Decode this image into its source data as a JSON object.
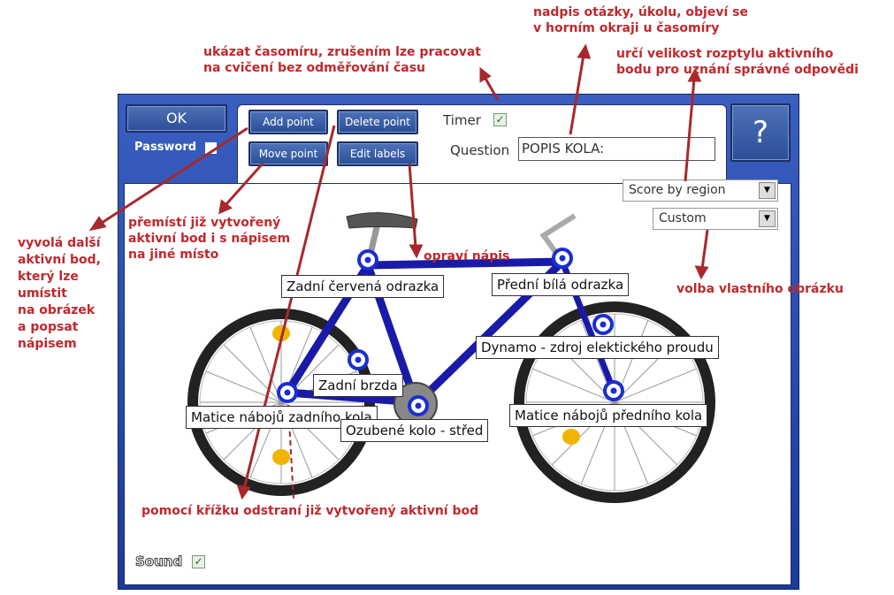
{
  "window": {
    "ok_label": "OK",
    "password_label": "Password",
    "help_label": "?",
    "toolbar": {
      "add_point": "Add point",
      "delete_point": "Delete point",
      "move_point": "Move point",
      "edit_labels": "Edit labels",
      "timer_label": "Timer",
      "timer_checked": true,
      "question_label": "Question",
      "question_value": "POPIS KOLA:"
    },
    "score_select": "Score by region",
    "image_select": "Custom",
    "sound_label": "Sound",
    "sound_checked": true,
    "check_mark": "✓"
  },
  "labels": [
    "Zadní červená odrazka",
    "Přední bílá odrazka",
    "Dynamo - zdroj elektického proudu",
    "Zadní brzda",
    "Matice nábojů zadního kola",
    "Ozubené kolo - střed",
    "Matice nábojů předního kola"
  ],
  "annotations": {
    "question": "nadpis otázky, úkolu, objeví se\nv horním okraji u časomíry",
    "timer": "ukázat časomíru, zrušením lze pracovat\nna cvičení bez odměřování času",
    "score": "určí velikost rozptylu aktivního\nbodu pro uznání správné odpovědi",
    "add": "vyvolá další\naktivní bod,\nkterý lze\numístit\nna obrázek\na popsat\nnápisem",
    "move": "přemístí již vytvořený\naktivní bod i s nápisem\nna jiné místo",
    "edit": "opraví nápis",
    "custom": "volba vlastního obrázku",
    "delete": "pomocí křížku odstraní již vytvořený aktivní bod"
  },
  "colors": {
    "annotation": "#c0282d",
    "frame": "#2a4fa8",
    "bike": "#1a1aa8",
    "point": "#1a2fd0"
  }
}
